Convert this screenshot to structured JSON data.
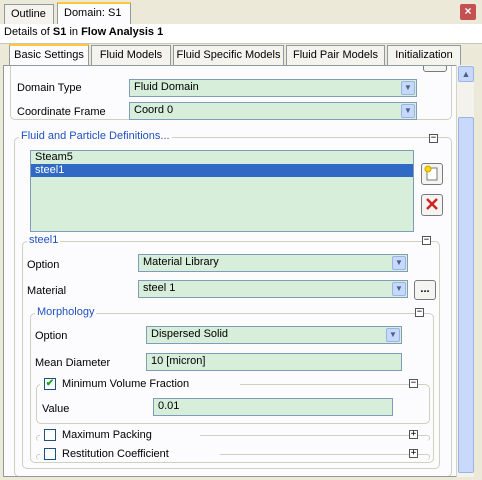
{
  "tabs": {
    "outline": "Outline",
    "domain": "Domain: S1"
  },
  "details": {
    "prefix": "Details of ",
    "object": "S1",
    "middle": " in ",
    "analysis": "Flow Analysis 1"
  },
  "inner_tabs": [
    "Basic Settings",
    "Fluid Models",
    "Fluid Specific Models",
    "Fluid Pair Models",
    "Initialization"
  ],
  "domain_type": {
    "label": "Domain Type",
    "value": "Fluid Domain"
  },
  "coordinate_frame": {
    "label": "Coordinate Frame",
    "value": "Coord 0"
  },
  "fluid_defs": {
    "title": "Fluid and Particle Definitions...",
    "items": [
      "Steam5",
      "steel1"
    ],
    "selected": "steel1"
  },
  "steel1": {
    "title": "steel1",
    "option": {
      "label": "Option",
      "value": "Material Library"
    },
    "material": {
      "label": "Material",
      "value": "steel 1",
      "browse": "..."
    }
  },
  "morphology": {
    "title": "Morphology",
    "option": {
      "label": "Option",
      "value": "Dispersed Solid"
    },
    "mean_diameter": {
      "label": "Mean Diameter",
      "value": "10 [micron]"
    }
  },
  "min_volume_fraction": {
    "label": "Minimum Volume Fraction",
    "checked": true,
    "value_label": "Value",
    "value": "0.01"
  },
  "max_packing": {
    "label": "Maximum Packing",
    "checked": false
  },
  "restitution": {
    "label": "Restitution Coefficient",
    "checked": false
  },
  "colors": {
    "field_bg": "#d7eedb",
    "group_title": "#2150c0",
    "selection": "#316ac5",
    "delete_red": "#cc2222"
  }
}
